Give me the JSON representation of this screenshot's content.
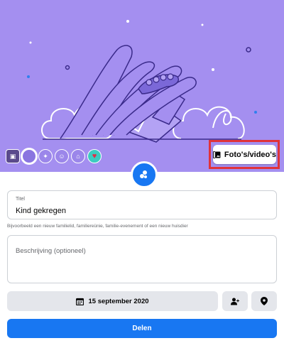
{
  "banner": {
    "background_color": "#a48ff0",
    "illustration": "hand-holding-hand-icon",
    "themes": [
      {
        "icon": "photo-icon"
      },
      {
        "icon": "circle-theme-icon"
      },
      {
        "icon": "stars-theme-icon"
      },
      {
        "icon": "baby-theme-icon"
      },
      {
        "icon": "family-theme-icon"
      },
      {
        "icon": "heart-theme-icon"
      }
    ],
    "media_button": {
      "label": "Foto's/video's",
      "icon": "photo-add-icon"
    }
  },
  "event_badge": {
    "icon": "life-event-icon",
    "color": "#1877f2"
  },
  "form": {
    "title_field": {
      "label": "Titel",
      "value": "Kind gekregen"
    },
    "title_hint": "Bijvoorbeeld een nieuw familielid, familiereünie, familie-evenement of een nieuw huisdier",
    "description_field": {
      "placeholder": "Beschrijving (optioneel)"
    },
    "date_button": {
      "label": "15 september 2020",
      "icon": "calendar-icon"
    },
    "tag_people_button": {
      "icon": "add-person-icon"
    },
    "location_button": {
      "icon": "location-pin-icon"
    },
    "share_button": {
      "label": "Delen",
      "color": "#1877f2"
    }
  }
}
